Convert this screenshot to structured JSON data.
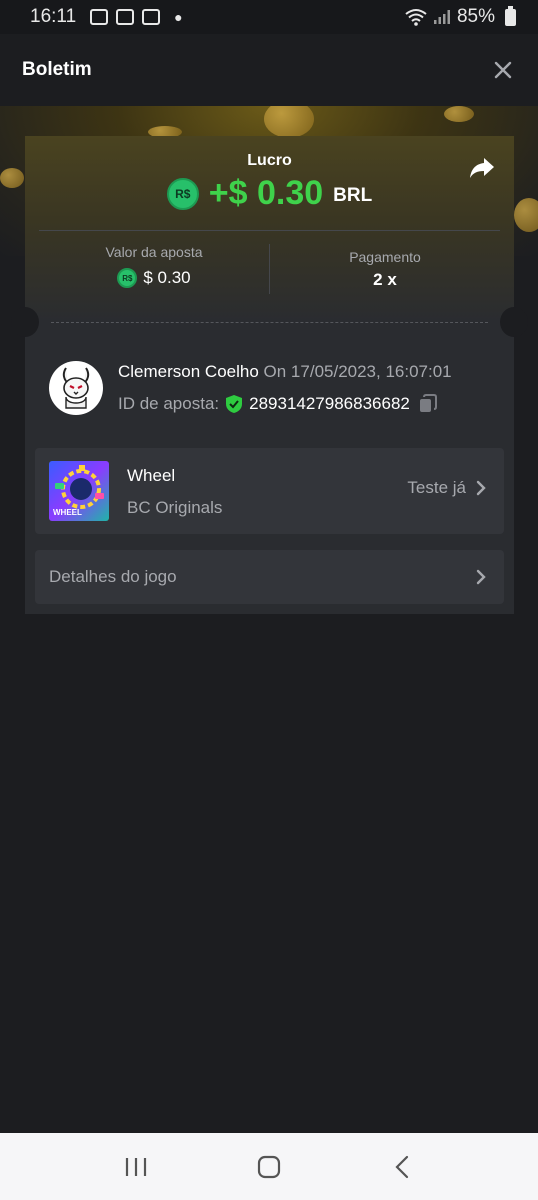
{
  "status_bar": {
    "time": "16:11",
    "battery": "85%"
  },
  "header": {
    "title": "Boletim"
  },
  "result": {
    "profit_label": "Lucro",
    "coin_symbol": "R$",
    "profit_amount": "+$ 0.30",
    "currency": "BRL"
  },
  "stats": {
    "bet_amount_label": "Valor da aposta",
    "bet_amount_value": "$ 0.30",
    "payout_label": "Pagamento",
    "payout_value": "2 x"
  },
  "bettor": {
    "name": "Clemerson Coelho",
    "date": "On 17/05/2023, 16:07:01",
    "bet_id_label": "ID de aposta:",
    "bet_id": "28931427986836682"
  },
  "game": {
    "thumb_text": "WHEEL",
    "name": "Wheel",
    "provider": "BC Originals",
    "try_label": "Teste já"
  },
  "details": {
    "label": "Detalhes do jogo"
  },
  "colors": {
    "profit": "#3fd24b",
    "coin": "#27c06a",
    "verified": "#2ecc40",
    "background": "#1c1d20",
    "card": "#2a2c30"
  }
}
